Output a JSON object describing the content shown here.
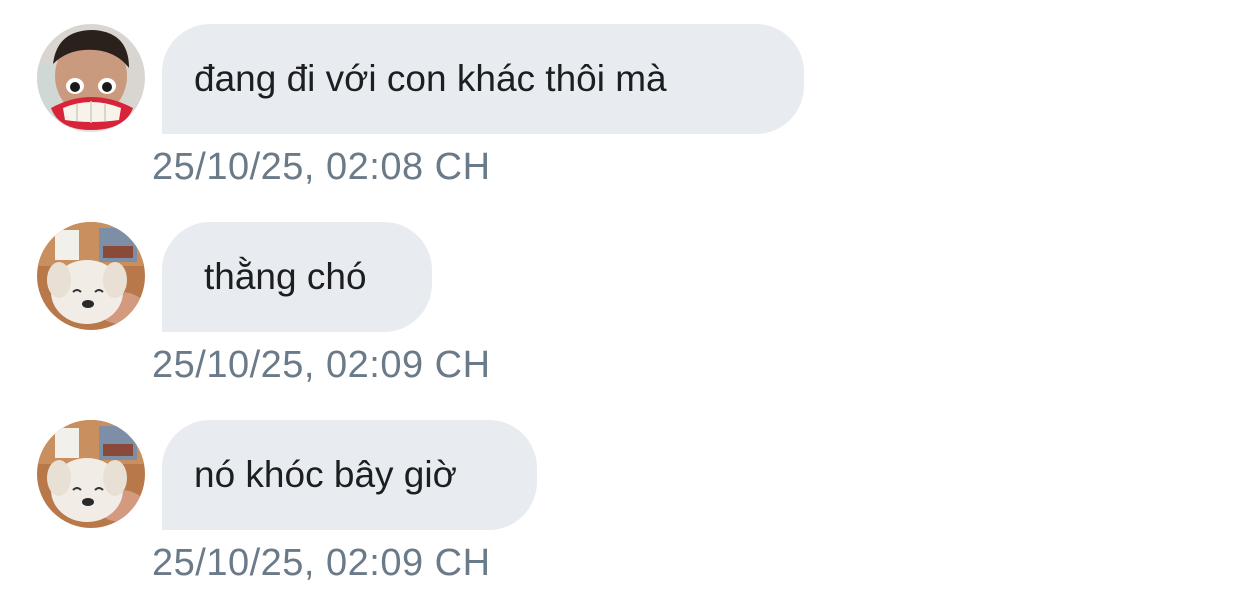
{
  "messages": [
    {
      "avatar": "person-avatar",
      "text": "đang đi với con khác thôi mà",
      "time": "25/10/25, 02:08 CH"
    },
    {
      "avatar": "puppy-avatar",
      "text": "thằng chó",
      "time": "25/10/25, 02:09 CH"
    },
    {
      "avatar": "puppy-avatar",
      "text": "nó khóc bây giờ",
      "time": "25/10/25, 02:09 CH"
    }
  ]
}
